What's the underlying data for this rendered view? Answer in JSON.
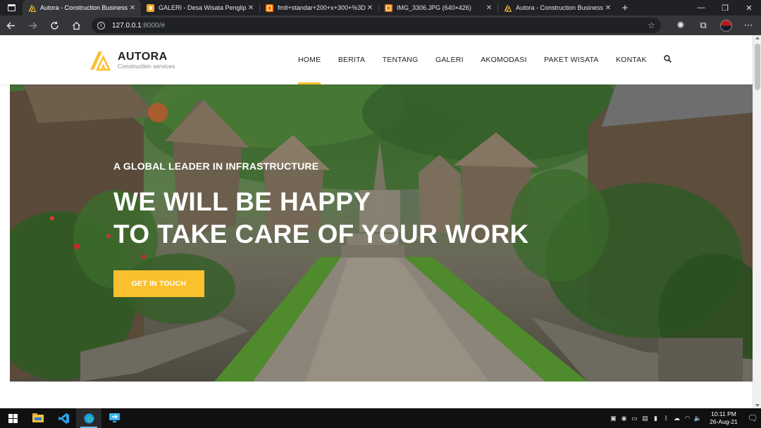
{
  "browser": {
    "tabs": [
      {
        "title": "Autora - Construction Business I",
        "favicon": "autora-logo-icon",
        "active": true
      },
      {
        "title": "GALERI - Desa Wisata Penglipura",
        "favicon": "page-yellow-icon",
        "active": false
      },
      {
        "title": "fmlt+standar+200+x+300+%3D",
        "favicon": "blogger-icon",
        "active": false
      },
      {
        "title": "IMG_3306.JPG (640×426)",
        "favicon": "blogger-icon",
        "active": false
      },
      {
        "title": "Autora - Construction Business I",
        "favicon": "autora-logo-icon",
        "active": false
      }
    ],
    "address": {
      "host": "127.0.0.1",
      "path": ":8000/#"
    }
  },
  "site": {
    "brand": "AUTORA",
    "tagline": "Construction services",
    "menu": [
      "HOME",
      "BERITA",
      "TENTANG",
      "GALERI",
      "AKOMODASI",
      "PAKET WISATA",
      "KONTAK"
    ],
    "active_menu": "HOME",
    "accent_color": "#fbc02d"
  },
  "hero": {
    "kicker": "A GLOBAL LEADER IN INFRASTRUCTURE",
    "title_line1": "WE WILL BE HAPPY",
    "title_line2": "TO TAKE CARE OF YOUR WORK",
    "cta": "GET IN TOUCH"
  },
  "taskbar": {
    "apps": [
      "file-explorer-icon",
      "vscode-icon",
      "edge-icon",
      "remote-desktop-icon"
    ],
    "time": "10:11 PM",
    "date": "26-Aug-21"
  }
}
